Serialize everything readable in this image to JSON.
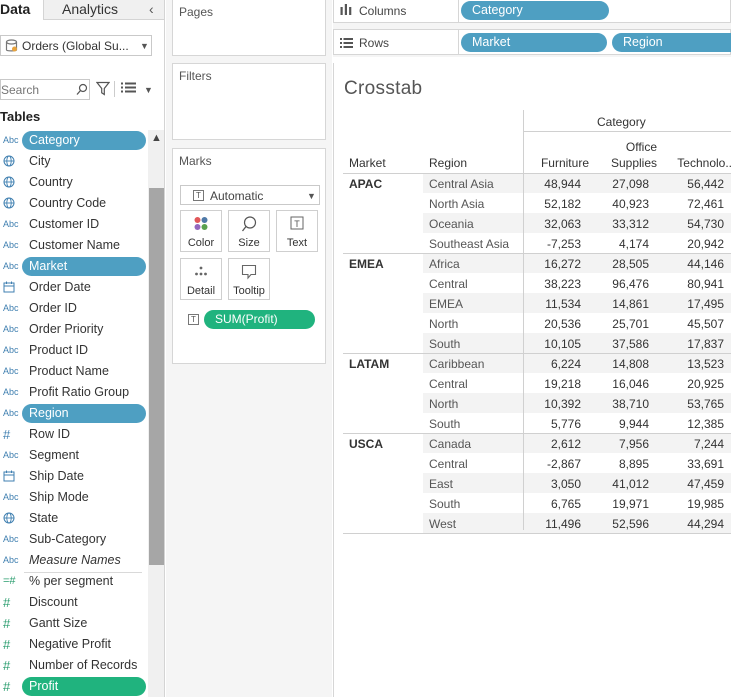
{
  "data_pane": {
    "tab_data": "Data",
    "tab_analytics": "Analytics",
    "data_source": "Orders (Global Su...",
    "search_placeholder": "Search",
    "tables_heading": "Tables",
    "fields": [
      {
        "label": "Category",
        "type": "Abc",
        "icon": "string-type-icon",
        "selected": "blue"
      },
      {
        "label": "City",
        "type": "geo",
        "icon": "globe-icon"
      },
      {
        "label": "Country",
        "type": "geo",
        "icon": "globe-icon"
      },
      {
        "label": "Country Code",
        "type": "geo",
        "icon": "globe-icon"
      },
      {
        "label": "Customer ID",
        "type": "Abc",
        "icon": "string-type-icon"
      },
      {
        "label": "Customer Name",
        "type": "Abc",
        "icon": "string-type-icon"
      },
      {
        "label": "Market",
        "type": "Abc",
        "icon": "string-type-icon",
        "selected": "blue"
      },
      {
        "label": "Order Date",
        "type": "date",
        "icon": "calendar-icon"
      },
      {
        "label": "Order ID",
        "type": "Abc",
        "icon": "string-type-icon"
      },
      {
        "label": "Order Priority",
        "type": "Abc",
        "icon": "string-type-icon"
      },
      {
        "label": "Product ID",
        "type": "Abc",
        "icon": "string-type-icon"
      },
      {
        "label": "Product Name",
        "type": "Abc",
        "icon": "string-type-icon"
      },
      {
        "label": "Profit Ratio Group",
        "type": "Abc",
        "icon": "string-type-icon"
      },
      {
        "label": "Region",
        "type": "Abc",
        "icon": "string-type-icon",
        "selected": "blue"
      },
      {
        "label": "Row ID",
        "type": "#",
        "icon": "number-type-icon"
      },
      {
        "label": "Segment",
        "type": "Abc",
        "icon": "string-type-icon"
      },
      {
        "label": "Ship Date",
        "type": "date",
        "icon": "calendar-icon"
      },
      {
        "label": "Ship Mode",
        "type": "Abc",
        "icon": "string-type-icon"
      },
      {
        "label": "State",
        "type": "geo",
        "icon": "globe-icon"
      },
      {
        "label": "Sub-Category",
        "type": "Abc",
        "icon": "string-type-icon"
      },
      {
        "label": "Measure Names",
        "type": "Abc",
        "icon": "string-type-icon",
        "italic": true
      },
      {
        "label": "% per segment",
        "type": "=#",
        "icon": "calculated-number-icon",
        "measure": true
      },
      {
        "label": "Discount",
        "type": "#",
        "icon": "number-type-icon",
        "measure": true
      },
      {
        "label": "Gantt Size",
        "type": "#",
        "icon": "number-type-icon",
        "measure": true
      },
      {
        "label": "Negative Profit",
        "type": "#",
        "icon": "number-type-icon",
        "measure": true
      },
      {
        "label": "Number of Records",
        "type": "#",
        "icon": "number-type-icon",
        "measure": true
      },
      {
        "label": "Profit",
        "type": "#",
        "icon": "number-type-icon",
        "measure": true,
        "selected": "green"
      }
    ]
  },
  "cards": {
    "pages_title": "Pages",
    "filters_title": "Filters",
    "marks_title": "Marks",
    "mark_type": "Automatic",
    "mark_buttons": [
      "Color",
      "Size",
      "Text",
      "Detail",
      "Tooltip"
    ],
    "text_pill": "SUM(Profit)"
  },
  "shelves": {
    "columns_label": "Columns",
    "rows_label": "Rows",
    "columns_pills": [
      "Category"
    ],
    "rows_pills": [
      "Market",
      "Region"
    ]
  },
  "viz": {
    "title": "Crosstab",
    "category_header": "Category",
    "market_header": "Market",
    "region_header": "Region",
    "column_headers": [
      "Furniture",
      "Office\nSupplies",
      "Technolo.."
    ]
  },
  "colors": {
    "dimension_pill": "#4e9fc2",
    "measure_pill": "#20b37e",
    "row_shade": "#f3f3f3"
  },
  "chart_data": {
    "type": "table",
    "title": "Crosstab",
    "columns": [
      "Furniture",
      "Office Supplies",
      "Technolo.."
    ],
    "groups": [
      {
        "market": "APAC",
        "rows": [
          {
            "region": "Central Asia",
            "values": [
              "48,944",
              "27,098",
              "56,442"
            ]
          },
          {
            "region": "North Asia",
            "values": [
              "52,182",
              "40,923",
              "72,461"
            ]
          },
          {
            "region": "Oceania",
            "values": [
              "32,063",
              "33,312",
              "54,730"
            ]
          },
          {
            "region": "Southeast Asia",
            "values": [
              "-7,253",
              "4,174",
              "20,942"
            ]
          }
        ]
      },
      {
        "market": "EMEA",
        "rows": [
          {
            "region": "Africa",
            "values": [
              "16,272",
              "28,505",
              "44,146"
            ]
          },
          {
            "region": "Central",
            "values": [
              "38,223",
              "96,476",
              "80,941"
            ]
          },
          {
            "region": "EMEA",
            "values": [
              "11,534",
              "14,861",
              "17,495"
            ]
          },
          {
            "region": "North",
            "values": [
              "20,536",
              "25,701",
              "45,507"
            ]
          },
          {
            "region": "South",
            "values": [
              "10,105",
              "37,586",
              "17,837"
            ]
          }
        ]
      },
      {
        "market": "LATAM",
        "rows": [
          {
            "region": "Caribbean",
            "values": [
              "6,224",
              "14,808",
              "13,523"
            ]
          },
          {
            "region": "Central",
            "values": [
              "19,218",
              "16,046",
              "20,925"
            ]
          },
          {
            "region": "North",
            "values": [
              "10,392",
              "38,710",
              "53,765"
            ]
          },
          {
            "region": "South",
            "values": [
              "5,776",
              "9,944",
              "12,385"
            ]
          }
        ]
      },
      {
        "market": "USCA",
        "rows": [
          {
            "region": "Canada",
            "values": [
              "2,612",
              "7,956",
              "7,244"
            ]
          },
          {
            "region": "Central",
            "values": [
              "-2,867",
              "8,895",
              "33,691"
            ]
          },
          {
            "region": "East",
            "values": [
              "3,050",
              "41,012",
              "47,459"
            ]
          },
          {
            "region": "South",
            "values": [
              "6,765",
              "19,971",
              "19,985"
            ]
          },
          {
            "region": "West",
            "values": [
              "11,496",
              "52,596",
              "44,294"
            ]
          }
        ]
      }
    ]
  }
}
